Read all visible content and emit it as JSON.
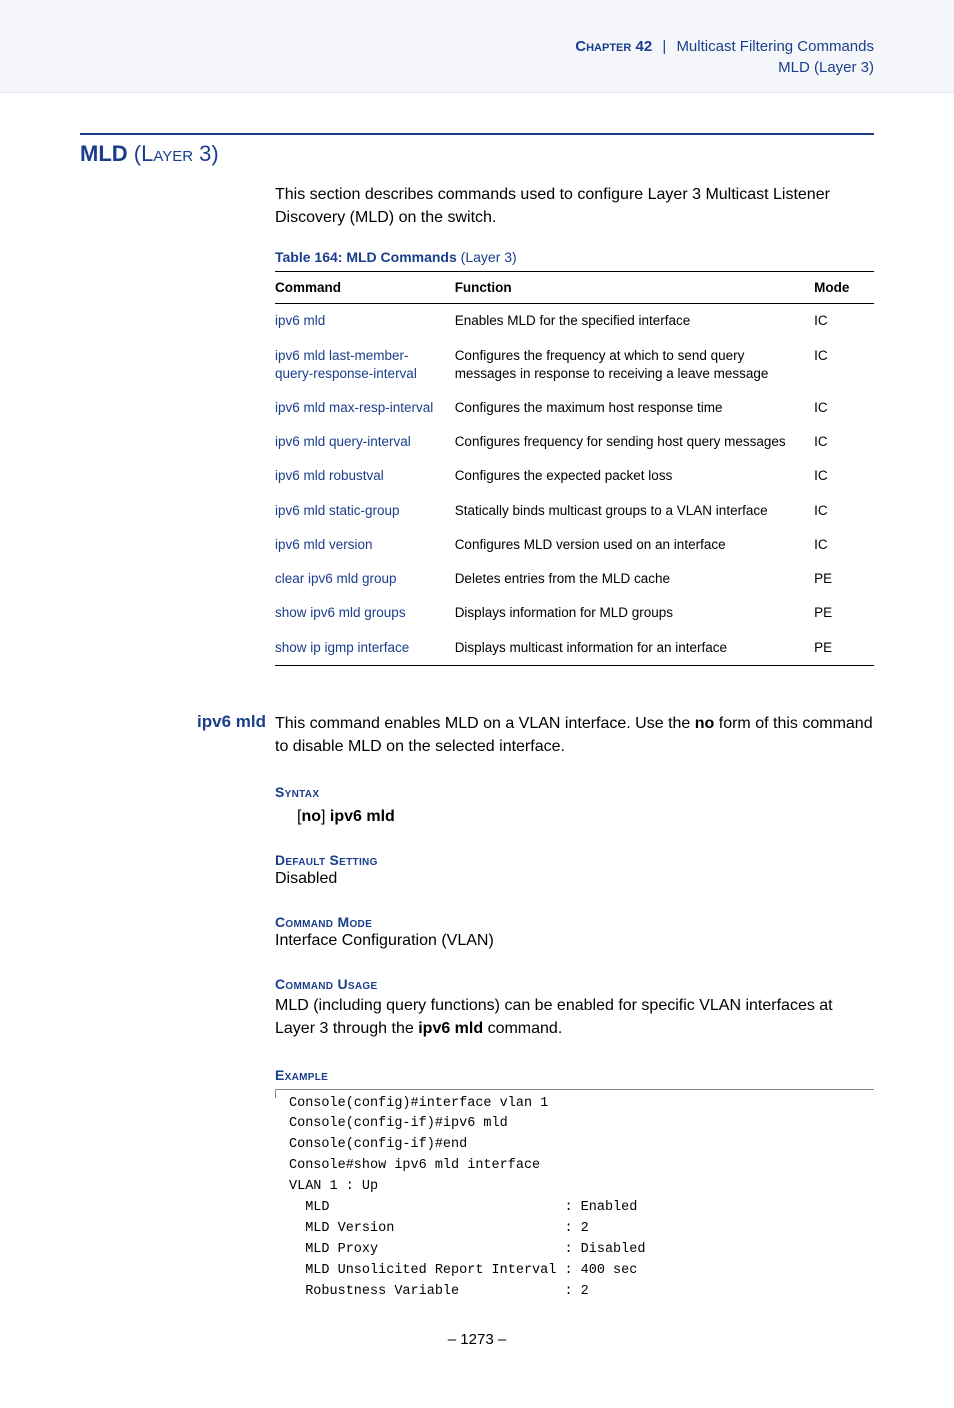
{
  "header": {
    "chapter_label": "Chapter 42",
    "separator": "|",
    "chapter_title": "Multicast Filtering Commands",
    "subtitle": "MLD (Layer 3)"
  },
  "section": {
    "title_bold": "MLD",
    "title_rest": " (Layer 3)",
    "intro": "This section describes commands used to configure Layer 3 Multicast Listener Discovery (MLD) on the switch."
  },
  "table": {
    "caption_bold": "Table 164: MLD Commands",
    "caption_rest": " (Layer 3)",
    "headers": {
      "command": "Command",
      "function": "Function",
      "mode": "Mode"
    },
    "rows": [
      {
        "command": "ipv6 mld",
        "function": "Enables MLD for the specified interface",
        "mode": "IC"
      },
      {
        "command": "ipv6 mld last-member-query-response-interval",
        "function": "Configures the frequency at which to send query messages in response to receiving a leave message",
        "mode": "IC"
      },
      {
        "command": "ipv6 mld max-resp-interval",
        "function": "Configures the maximum host response time",
        "mode": "IC"
      },
      {
        "command": "ipv6 mld query-interval",
        "function": "Configures frequency for sending host query messages",
        "mode": "IC"
      },
      {
        "command": "ipv6 mld robustval",
        "function": "Configures the expected packet loss",
        "mode": "IC"
      },
      {
        "command": "ipv6 mld static-group",
        "function": "Statically binds multicast groups to a VLAN interface",
        "mode": "IC"
      },
      {
        "command": "ipv6 mld version",
        "function": "Configures MLD version used on an interface",
        "mode": "IC"
      },
      {
        "command": "clear ipv6 mld group",
        "function": "Deletes entries from the MLD cache",
        "mode": "PE"
      },
      {
        "command": "show ipv6 mld groups",
        "function": "Displays information for MLD groups",
        "mode": "PE"
      },
      {
        "command": "show ip igmp interface",
        "function": "Displays multicast information for an interface",
        "mode": "PE"
      }
    ]
  },
  "command_detail": {
    "margin_label": "ipv6 mld",
    "desc_pre": "This command enables MLD on a VLAN interface. Use the ",
    "desc_bold": "no",
    "desc_post": " form of this command to disable MLD on the selected interface.",
    "syntax_label": "Syntax",
    "syntax_open": "[",
    "syntax_no": "no",
    "syntax_close": "]",
    "syntax_cmd": " ipv6 mld",
    "default_label": "Default Setting",
    "default_value": "Disabled",
    "mode_label": "Command Mode",
    "mode_value": "Interface Configuration (VLAN)",
    "usage_label": "Command Usage",
    "usage_pre": "MLD (including query functions) can be enabled for specific VLAN interfaces at Layer 3 through the ",
    "usage_bold": "ipv6 mld",
    "usage_post": " command.",
    "example_label": "Example",
    "example_text": "Console(config)#interface vlan 1\nConsole(config-if)#ipv6 mld\nConsole(config-if)#end\nConsole#show ipv6 mld interface\nVLAN 1 : Up\n  MLD                             : Enabled\n  MLD Version                     : 2\n  MLD Proxy                       : Disabled\n  MLD Unsolicited Report Interval : 400 sec\n  Robustness Variable             : 2"
  },
  "page_number": "–  1273  –"
}
